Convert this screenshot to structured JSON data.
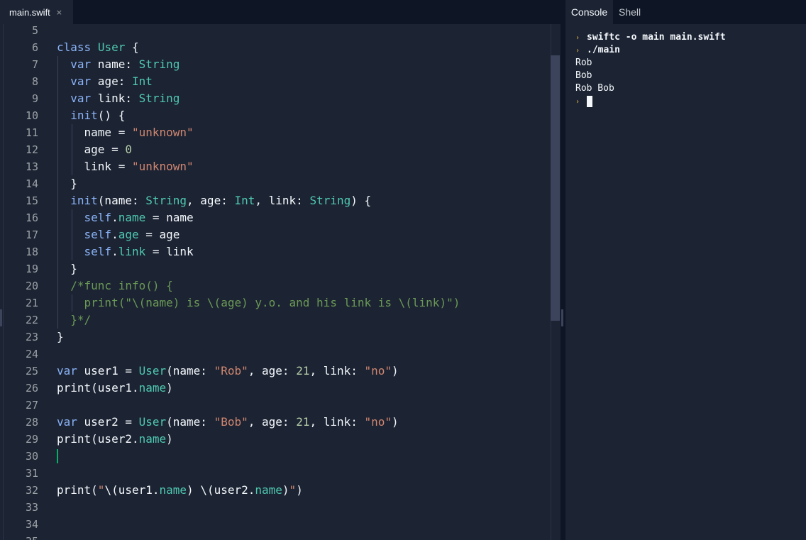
{
  "editor": {
    "tab_label": "main.swift",
    "tab_close": "×",
    "first_line_number": 5,
    "lines": [
      "",
      "class User {",
      "  var name: String",
      "  var age: Int",
      "  var link: String",
      "  init() {",
      "    name = \"unknown\"",
      "    age = 0",
      "    link = \"unknown\"",
      "  }",
      "  init(name: String, age: Int, link: String) {",
      "    self.name = name",
      "    self.age = age",
      "    self.link = link",
      "  }",
      "  /*func info() {",
      "    print(\"\\(name) is \\(age) y.o. and his link is \\(link)\")",
      "  }*/",
      "}",
      "",
      "var user1 = User(name: \"Rob\", age: 21, link: \"no\")",
      "print(user1.name)",
      "",
      "var user2 = User(name: \"Bob\", age: 21, link: \"no\")",
      "print(user2.name)",
      "",
      "",
      "print(\"\\(user1.name) \\(user2.name)\")",
      "",
      "",
      ""
    ]
  },
  "console": {
    "tabs": [
      "Console",
      "Shell"
    ],
    "prompt_glyph": "›",
    "lines": [
      {
        "type": "command",
        "text": "swiftc -o main main.swift"
      },
      {
        "type": "command",
        "text": "./main"
      },
      {
        "type": "output",
        "text": "Rob"
      },
      {
        "type": "output",
        "text": "Bob"
      },
      {
        "type": "output",
        "text": "Rob Bob"
      },
      {
        "type": "prompt",
        "text": ""
      }
    ]
  },
  "colors": {
    "background": "#1c2333",
    "tabbar": "#0e1525",
    "keyword": "#8ab4f8",
    "type": "#4fc9b0",
    "string": "#d08770",
    "number": "#b5cea8",
    "comment": "#6a9955",
    "prompt": "#e3b341",
    "cursor": "#00b16a"
  }
}
